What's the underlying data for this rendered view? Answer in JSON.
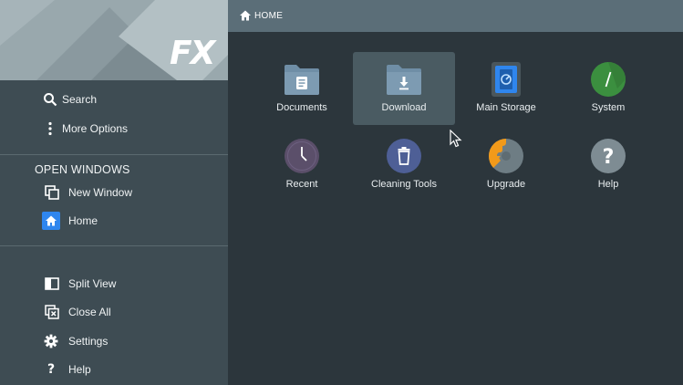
{
  "app": {
    "logo_text": "FX"
  },
  "sidebar": {
    "top_items": [
      {
        "label": "Search",
        "icon": "search-icon"
      },
      {
        "label": "More Options",
        "icon": "more-vert-icon"
      }
    ],
    "windows_section_title": "OPEN WINDOWS",
    "window_items": [
      {
        "label": "New Window",
        "icon": "new-window-icon"
      },
      {
        "label": "Home",
        "icon": "home-icon",
        "active": true
      }
    ],
    "bottom_items": [
      {
        "label": "Split View",
        "icon": "split-view-icon"
      },
      {
        "label": "Close All",
        "icon": "close-all-icon"
      },
      {
        "label": "Settings",
        "icon": "gear-icon"
      },
      {
        "label": "Help",
        "icon": "question-icon"
      }
    ]
  },
  "topbar": {
    "breadcrumb": "Home",
    "icon": "home-icon"
  },
  "grid": {
    "items": [
      {
        "label": "Documents",
        "icon": "documents-folder-icon"
      },
      {
        "label": "Download",
        "icon": "download-folder-icon",
        "selected": true
      },
      {
        "label": "Main Storage",
        "icon": "storage-icon"
      },
      {
        "label": "System",
        "icon": "system-root-icon"
      },
      {
        "label": "Recent",
        "icon": "clock-icon"
      },
      {
        "label": "Cleaning Tools",
        "icon": "trash-icon"
      },
      {
        "label": "Upgrade",
        "icon": "puzzle-icon"
      },
      {
        "label": "Help",
        "icon": "help-question-icon"
      }
    ]
  },
  "colors": {
    "sidebar_bg": "#3e4c53",
    "content_bg": "#2c363c",
    "topbar_bg": "#5b6e78",
    "accent_blue": "#2f86ee",
    "folder": "#6f8ea6",
    "system_green": "#3b8f3f",
    "upgrade_orange": "#f29a1a"
  }
}
